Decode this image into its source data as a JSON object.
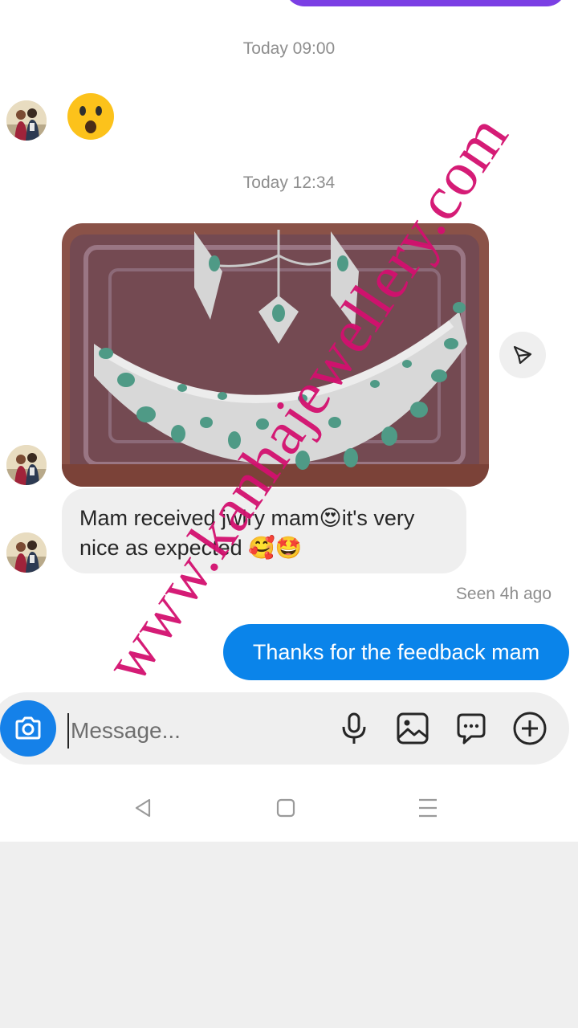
{
  "conversation": {
    "timestamp_1": "Today 09:00",
    "timestamp_2": "Today 12:34",
    "received_text": "Mam received jwlry mam😍it's very nice as expected 🥰🤩",
    "seen_status": "Seen 4h ago",
    "sent_text": "Thanks for the feedback mam"
  },
  "composer": {
    "placeholder": "Message...",
    "icons": [
      "camera-icon",
      "microphone-icon",
      "gallery-icon",
      "sticker-chat-icon",
      "plus-icon"
    ]
  },
  "nav": {
    "icons": [
      "back-triangle-icon",
      "home-square-icon",
      "menu-lines-icon"
    ]
  },
  "watermark": {
    "text": "www.kanhajewellery.com"
  },
  "colors": {
    "sent_bubble": "#0a84ea",
    "received_bubble": "#efefef",
    "camera_button": "#1581e9",
    "watermark": "#d3106f",
    "top_bubble": "#7b3fe4"
  }
}
